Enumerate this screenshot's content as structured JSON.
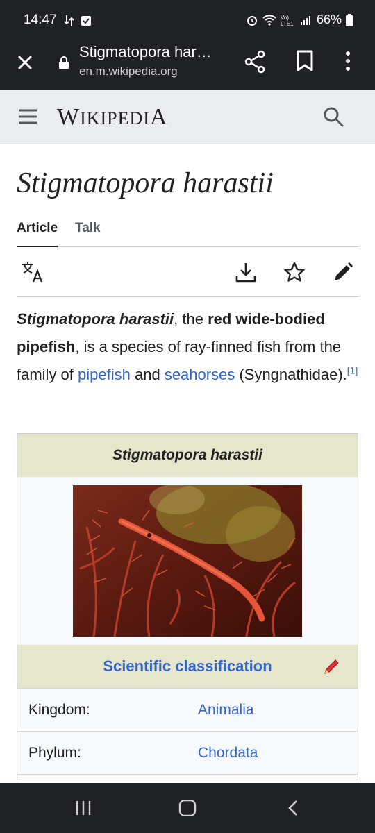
{
  "status": {
    "time": "14:47",
    "battery": "66%"
  },
  "browser": {
    "tab_title": "Stigmatopora har…",
    "url": "en.m.wikipedia.org"
  },
  "header": {
    "wordmark_w": "W",
    "wordmark_iki": "IKIPEDI",
    "wordmark_a": "A"
  },
  "article": {
    "title": "Stigmatopora harastii",
    "tabs": [
      {
        "label": "Article"
      },
      {
        "label": "Talk"
      }
    ],
    "lead": {
      "species": "Stigmatopora harastii",
      "t1": ", the ",
      "common_name": "red wide-bodied pipefish",
      "t2": ", is a species of ray-finned fish from the family of ",
      "link1": "pipefish",
      "t3": " and ",
      "link2": "seahorses",
      "t4": " (Syngnathidae).",
      "ref": "[1]"
    }
  },
  "infobox": {
    "title": "Stigmatopora harastii",
    "classification_heading": "Scientific classification",
    "rows": [
      {
        "key": "Kingdom:",
        "value": "Animalia"
      },
      {
        "key": "Phylum:",
        "value": "Chordata"
      }
    ]
  },
  "colors": {
    "link": "#3366cc",
    "infobox_header": "#e6e6cc",
    "chrome": "#202124"
  }
}
